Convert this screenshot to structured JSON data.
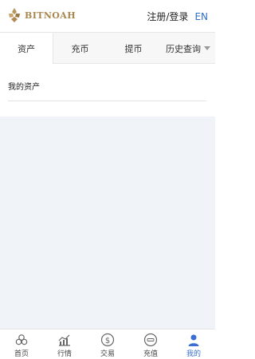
{
  "header": {
    "brand": "BITNOAH",
    "login_label": "注册/登录",
    "lang_label": "EN"
  },
  "tabs": [
    {
      "label": "资产",
      "active": true
    },
    {
      "label": "充币",
      "active": false
    },
    {
      "label": "提币",
      "active": false
    },
    {
      "label": "历史查询",
      "active": false,
      "has_dropdown": true
    }
  ],
  "main": {
    "section_title": "我的资产"
  },
  "bottom_nav": [
    {
      "label": "首页",
      "icon": "home-icon",
      "active": false
    },
    {
      "label": "行情",
      "icon": "chart-icon",
      "active": false
    },
    {
      "label": "交易",
      "icon": "dollar-icon",
      "active": false
    },
    {
      "label": "充值",
      "icon": "coin-icon",
      "active": false
    },
    {
      "label": "我的",
      "icon": "user-icon",
      "active": true
    }
  ],
  "colors": {
    "brand_gold": "#a8864e",
    "link_blue": "#2f6fc6",
    "body_bg": "#f0f3f8"
  }
}
